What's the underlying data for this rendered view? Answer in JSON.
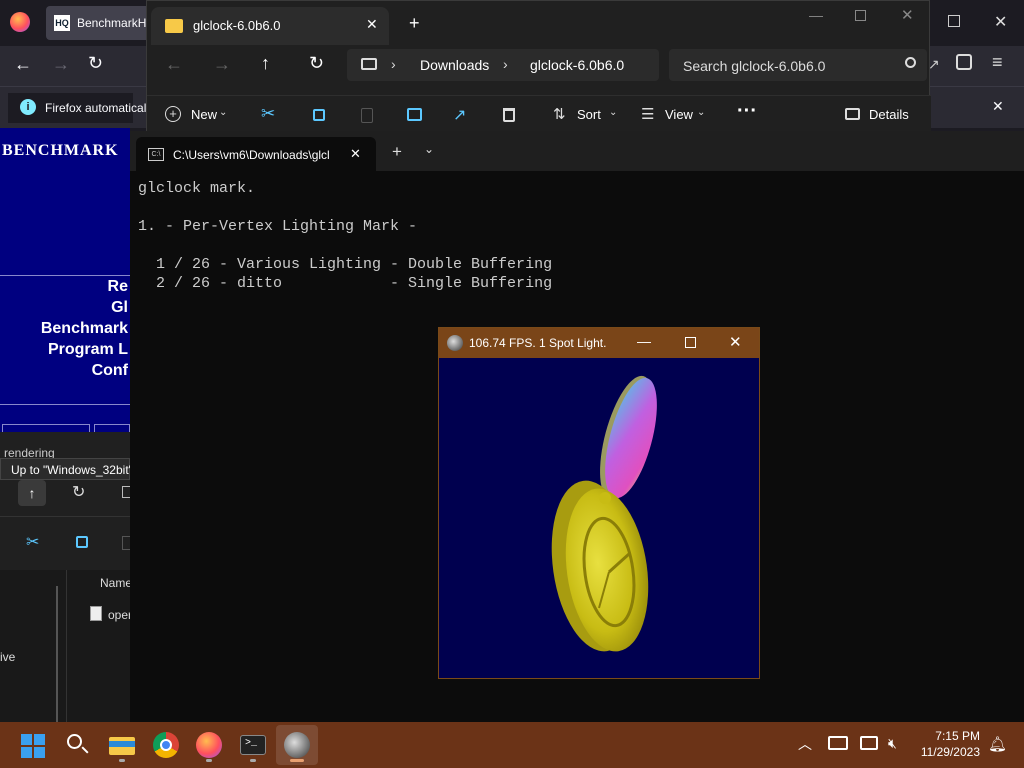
{
  "firefox": {
    "tab_title": "BenchmarkH",
    "notification_text": "Firefox automaticall",
    "brand": "BENCHMARK",
    "menu_items": [
      "Re",
      "Gl",
      "Benchmark",
      "Program L",
      "Conf"
    ]
  },
  "ghost_explorer": {
    "tooltip": "Up to \"Windows_32bit\"",
    "status": "rendering",
    "col_name": "Name",
    "file_partial": "oper",
    "nav_partial": "ive"
  },
  "explorer": {
    "tab_title": "glclock-6.0b6.0",
    "breadcrumb": [
      "Downloads",
      "glclock-6.0b6.0"
    ],
    "search_placeholder": "Search glclock-6.0b6.0",
    "cmd": {
      "new": "New",
      "sort": "Sort",
      "view": "View",
      "details": "Details"
    }
  },
  "terminal": {
    "tab_title": "C:\\Users\\vm6\\Downloads\\glcl",
    "lines": [
      "glclock mark.",
      "",
      "1. - Per-Vertex Lighting Mark -",
      "",
      "  1 / 26 - Various Lighting - Double Buffering",
      "  2 / 26 - ditto            - Single Buffering"
    ]
  },
  "glclock": {
    "title": "106.74 FPS.  1 Spot Light."
  },
  "taskbar": {
    "time": "7:15 PM",
    "date": "11/29/2023"
  },
  "colors": {
    "taskbar": "#6b3317",
    "gl_background": "#00004f",
    "bench_background": "#000080",
    "clock_gold": "#d4c81a"
  }
}
